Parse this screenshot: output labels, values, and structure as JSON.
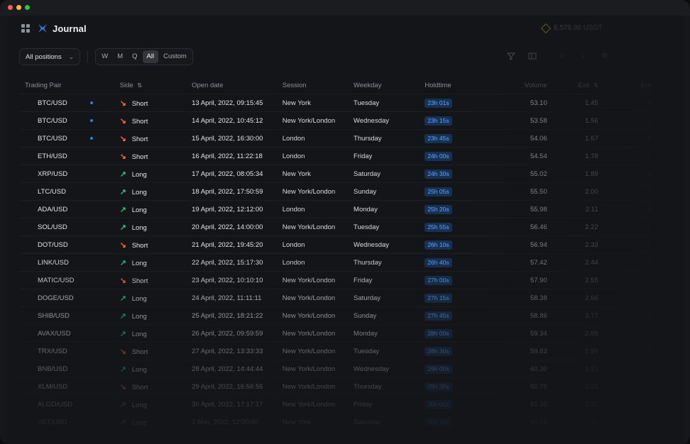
{
  "app": {
    "title": "Journal",
    "balance": "6,578.98 USDT"
  },
  "filters": {
    "positions_dropdown": "All positions",
    "periods": [
      {
        "label": "W",
        "active": false
      },
      {
        "label": "M",
        "active": false
      },
      {
        "label": "Q",
        "active": false
      },
      {
        "label": "All",
        "active": true
      },
      {
        "label": "Custom",
        "active": false
      }
    ]
  },
  "toolbar_icons": [
    "filter-icon",
    "columns-icon",
    "star-icon",
    "search-icon",
    "settings-icon"
  ],
  "table": {
    "headers": {
      "pair": "Trading Pair",
      "side": "Side",
      "date": "Open date",
      "session": "Session",
      "weekday": "Weekday",
      "holdtime": "Holdtime",
      "volume": "Volume",
      "exit": "Exit",
      "last": "Ent"
    },
    "rows": [
      {
        "pair": "BTC/USD",
        "marker": true,
        "side": "Short",
        "date": "13 April, 2022, 09:15:45",
        "session": "New York",
        "weekday": "Tuesday",
        "hold": "23h 01s",
        "volume": "53.10",
        "exit": "1.45",
        "last": "3"
      },
      {
        "pair": "BTC/USD",
        "marker": true,
        "side": "Short",
        "date": "14 April, 2022, 10:45:12",
        "session": "New York/London",
        "weekday": "Wednesday",
        "hold": "23h 15s",
        "volume": "53.58",
        "exit": "1.56",
        "last": "2"
      },
      {
        "pair": "BTC/USD",
        "marker": true,
        "side": "Short",
        "date": "15 April, 2022, 16:30:00",
        "session": "London",
        "weekday": "Thursday",
        "hold": "23h 45s",
        "volume": "54.06",
        "exit": "1.67",
        "last": "4"
      },
      {
        "pair": "ETH/USD",
        "marker": false,
        "side": "Short",
        "date": "16 April, 2022, 11:22:18",
        "session": "London",
        "weekday": "Friday",
        "hold": "24h 00s",
        "volume": "54.54",
        "exit": "1.78",
        "last": "1"
      },
      {
        "pair": "XRP/USD",
        "marker": false,
        "side": "Long",
        "date": "17 April, 2022, 08:05:34",
        "session": "New York",
        "weekday": "Saturday",
        "hold": "24h 30s",
        "volume": "55.02",
        "exit": "1.89",
        "last": "6"
      },
      {
        "pair": "LTC/USD",
        "marker": false,
        "side": "Long",
        "date": "18 April, 2022, 17:50:59",
        "session": "New York/London",
        "weekday": "Sunday",
        "hold": "25h 05s",
        "volume": "55.50",
        "exit": "2.00",
        "last": "7"
      },
      {
        "pair": "ADA/USD",
        "marker": false,
        "side": "Long",
        "date": "19 April, 2022, 12:12:00",
        "session": "London",
        "weekday": "Monday",
        "hold": "25h 20s",
        "volume": "55.98",
        "exit": "2.11",
        "last": "3"
      },
      {
        "pair": "SOL/USD",
        "marker": false,
        "side": "Long",
        "date": "20 April, 2022, 14:00:00",
        "session": "New York/London",
        "weekday": "Tuesday",
        "hold": "25h 55s",
        "volume": "56.46",
        "exit": "2.22",
        "last": "1"
      },
      {
        "pair": "DOT/USD",
        "marker": false,
        "side": "Short",
        "date": "21 April, 2022, 19:45:20",
        "session": "London",
        "weekday": "Wednesday",
        "hold": "26h 10s",
        "volume": "56.94",
        "exit": "2.33",
        "last": "5"
      },
      {
        "pair": "LINK/USD",
        "marker": false,
        "side": "Long",
        "date": "22 April, 2022, 15:17:30",
        "session": "London",
        "weekday": "Thursday",
        "hold": "26h 40s",
        "volume": "57.42",
        "exit": "2.44",
        "last": "2"
      },
      {
        "pair": "MATIC/USD",
        "marker": false,
        "side": "Short",
        "date": "23 April, 2022, 10:10:10",
        "session": "New York/London",
        "weekday": "Friday",
        "hold": "27h 00s",
        "volume": "57.90",
        "exit": "2.55",
        "last": "4"
      },
      {
        "pair": "DOGE/USD",
        "marker": false,
        "side": "Long",
        "date": "24 April, 2022, 11:11:11",
        "session": "New York/London",
        "weekday": "Saturday",
        "hold": "27h 15s",
        "volume": "58.38",
        "exit": "2.66",
        "last": "6"
      },
      {
        "pair": "SHIB/USD",
        "marker": false,
        "side": "Long",
        "date": "25 April, 2022, 18:21:22",
        "session": "New York/London",
        "weekday": "Sunday",
        "hold": "27h 45s",
        "volume": "58.86",
        "exit": "2.77",
        "last": "3"
      },
      {
        "pair": "AVAX/USD",
        "marker": false,
        "side": "Long",
        "date": "26 April, 2022, 09:59:59",
        "session": "New York/London",
        "weekday": "Monday",
        "hold": "28h 00s",
        "volume": "59.34",
        "exit": "2.88",
        "last": "1"
      },
      {
        "pair": "TRX/USD",
        "marker": false,
        "side": "Short",
        "date": "27 April, 2022, 13:33:33",
        "session": "New York/London",
        "weekday": "Tuesday",
        "hold": "28h 30s",
        "volume": "59.82",
        "exit": "2.99",
        "last": "2"
      },
      {
        "pair": "BNB/USD",
        "marker": false,
        "side": "Long",
        "date": "28 April, 2022, 14:44:44",
        "session": "New York/London",
        "weekday": "Wednesday",
        "hold": "29h 00s",
        "volume": "60.30",
        "exit": "3.10",
        "last": "5"
      },
      {
        "pair": "XLM/USD",
        "marker": false,
        "side": "Short",
        "date": "29 April, 2022, 16:56:56",
        "session": "New York/London",
        "weekday": "Thursday",
        "hold": "29h 30s",
        "volume": "60.78",
        "exit": "3.21",
        "last": "3"
      },
      {
        "pair": "ALGO/USD",
        "marker": false,
        "side": "Long",
        "date": "30 April, 2022, 17:17:17",
        "session": "New York/London",
        "weekday": "Friday",
        "hold": "30h 00s",
        "volume": "61.26",
        "exit": "3.32",
        "last": "4"
      },
      {
        "pair": "VET/USD",
        "marker": false,
        "side": "Long",
        "date": "1 May, 2022, 12:00:00",
        "session": "New York",
        "weekday": "Saturday",
        "hold": "30h 30s",
        "volume": "61.74",
        "exit": "3.43",
        "last": "2"
      }
    ]
  }
}
